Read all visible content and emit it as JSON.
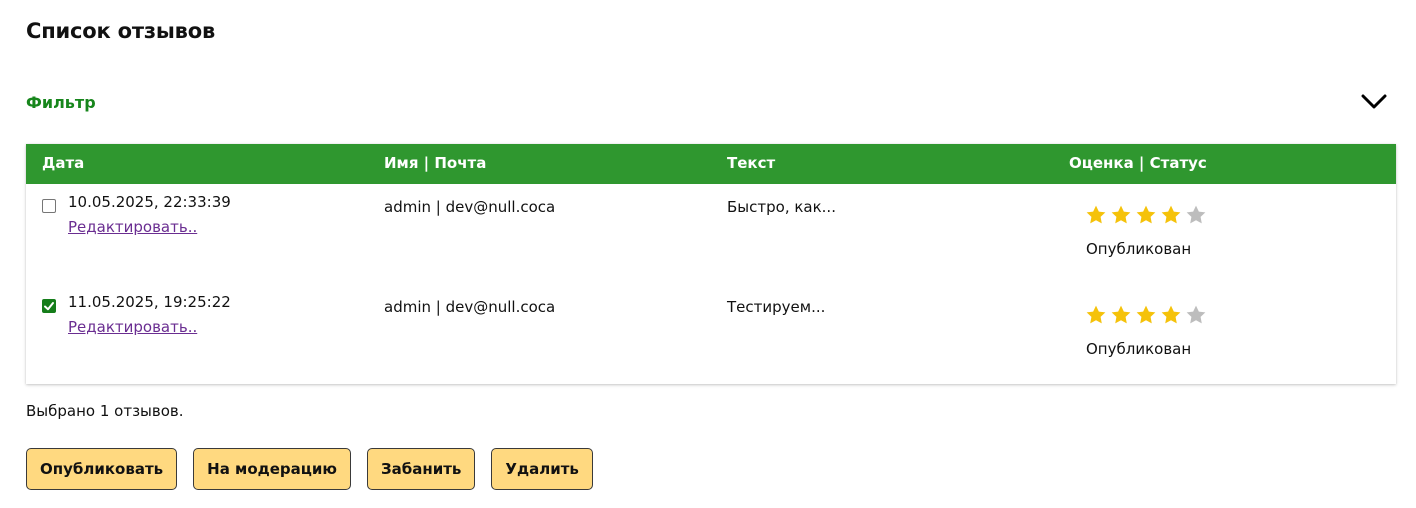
{
  "page": {
    "title": "Список отзывов"
  },
  "filter": {
    "title": "Фильтр",
    "toggle_icon": "chevron-down-icon"
  },
  "table": {
    "headers": {
      "date": "Дата",
      "name_email": "Имя | Почта",
      "text": "Текст",
      "rating_status": "Оценка | Статус"
    },
    "rows": [
      {
        "checked": false,
        "date": "10.05.2025, 22:33:39",
        "edit_label": "Редактировать..",
        "name_email": "admin | dev@null.coca",
        "text": "Быстро, как...",
        "rating": 4,
        "rating_max": 5,
        "status": "Опубликован"
      },
      {
        "checked": true,
        "date": "11.05.2025, 19:25:22",
        "edit_label": "Редактировать..",
        "name_email": "admin | dev@null.coca",
        "text": "Тестируем...",
        "rating": 4,
        "rating_max": 5,
        "status": "Опубликован"
      }
    ]
  },
  "selection": {
    "summary": "Выбрано 1 отзывов."
  },
  "actions": {
    "publish": "Опубликовать",
    "moderate": "На модерацию",
    "ban": "Забанить",
    "delete": "Удалить"
  },
  "colors": {
    "header_green": "#2f972f",
    "filter_green": "#17861c",
    "checkbox_green": "#157d1a",
    "star_filled": "#f5c20a",
    "star_empty": "#bdbdbd",
    "button_bg": "#ffd980",
    "link_purple": "#6a2d91"
  }
}
